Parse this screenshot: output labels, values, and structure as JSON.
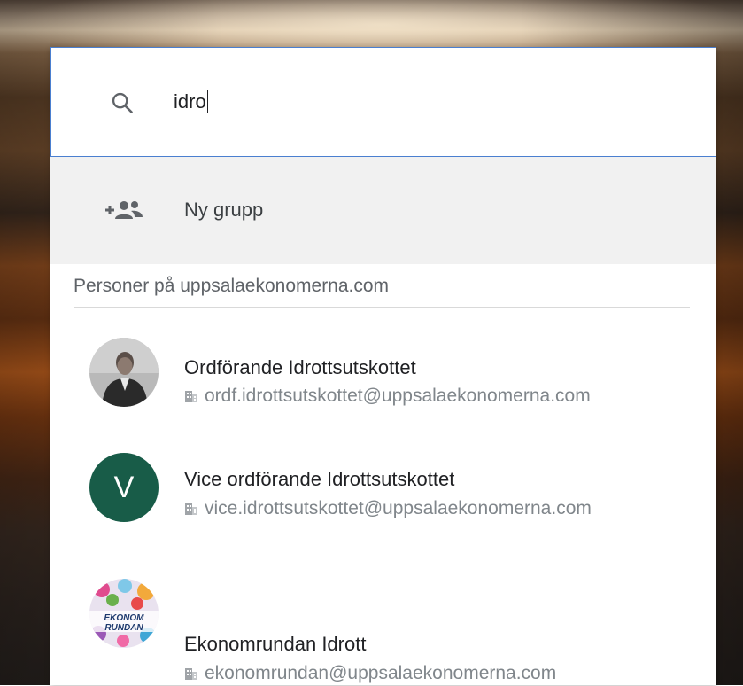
{
  "search": {
    "query": "idro"
  },
  "new_group": {
    "label": "Ny grupp",
    "icon": "add-group-icon"
  },
  "people_section": {
    "header": "Personer på uppsalaekonomerna.com",
    "results": [
      {
        "name": "Ordförande Idrottsutskottet",
        "email": "ordf.idrottsutskottet@uppsalaekonomerna.com",
        "avatar_type": "photo"
      },
      {
        "name": "Vice ordförande Idrottsutskottet",
        "email": "vice.idrottsutskottet@uppsalaekonomerna.com",
        "avatar_type": "letter",
        "avatar_letter": "V",
        "avatar_color": "#185c48"
      },
      {
        "name": "Ekonomrundan Idrott",
        "email": "ekonomrundan@uppsalaekonomerna.com",
        "avatar_type": "logo",
        "logo_text": "EKONOM RUNDAN"
      }
    ]
  },
  "colors": {
    "focus_border": "#4a7fd0",
    "new_group_bg": "#f1f1f1",
    "secondary_text": "#80868b"
  }
}
